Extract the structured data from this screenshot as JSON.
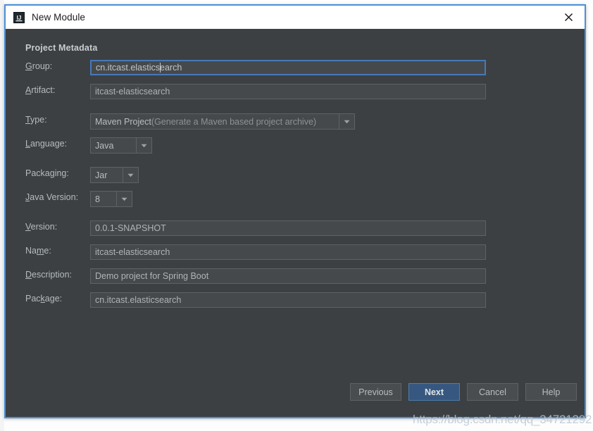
{
  "window": {
    "title": "New Module",
    "icon": "intellij-idea-icon",
    "close_icon": "close-icon",
    "border_color": "#4a90d9",
    "titlebar_bg": "#ffffff",
    "body_bg": "#3c4043"
  },
  "section": {
    "heading": "Project Metadata"
  },
  "fields": {
    "group": {
      "label_prefix": "",
      "label_mnemonic": "G",
      "label_suffix": "roup:",
      "value_before_caret": "cn.itcast.elastics",
      "value_after_caret": "earch",
      "value": "cn.itcast.elasticsearch",
      "focused": true
    },
    "artifact": {
      "label_prefix": "",
      "label_mnemonic": "A",
      "label_suffix": "rtifact:",
      "value": "itcast-elasticsearch"
    },
    "type": {
      "label_prefix": "",
      "label_mnemonic": "T",
      "label_suffix": "ype:",
      "value": "Maven Project",
      "value_hint": " (Generate a Maven based project archive)"
    },
    "language": {
      "label_prefix": "",
      "label_mnemonic": "L",
      "label_suffix": "anguage:",
      "value": "Java"
    },
    "packaging": {
      "label_prefix": "Packa",
      "label_mnemonic": "g",
      "label_suffix": "ing:",
      "value": "Jar"
    },
    "java_version": {
      "label_prefix": "",
      "label_mnemonic": "J",
      "label_suffix": "ava Version:",
      "value": "8"
    },
    "version": {
      "label_prefix": "",
      "label_mnemonic": "V",
      "label_suffix": "ersion:",
      "value": "0.0.1-SNAPSHOT"
    },
    "name": {
      "label_prefix": "Na",
      "label_mnemonic": "m",
      "label_suffix": "e:",
      "value": "itcast-elasticsearch"
    },
    "description": {
      "label_prefix": "",
      "label_mnemonic": "D",
      "label_suffix": "escription:",
      "value": "Demo project for Spring Boot"
    },
    "package": {
      "label_prefix": "Pac",
      "label_mnemonic": "k",
      "label_suffix": "age:",
      "value": "cn.itcast.elasticsearch"
    }
  },
  "buttons": {
    "previous": "Previous",
    "next": "Next",
    "cancel": "Cancel",
    "help": "Help",
    "primary_color": "#365880"
  },
  "watermark": {
    "text": "https://blog.csdn.net/qq_34721292"
  }
}
